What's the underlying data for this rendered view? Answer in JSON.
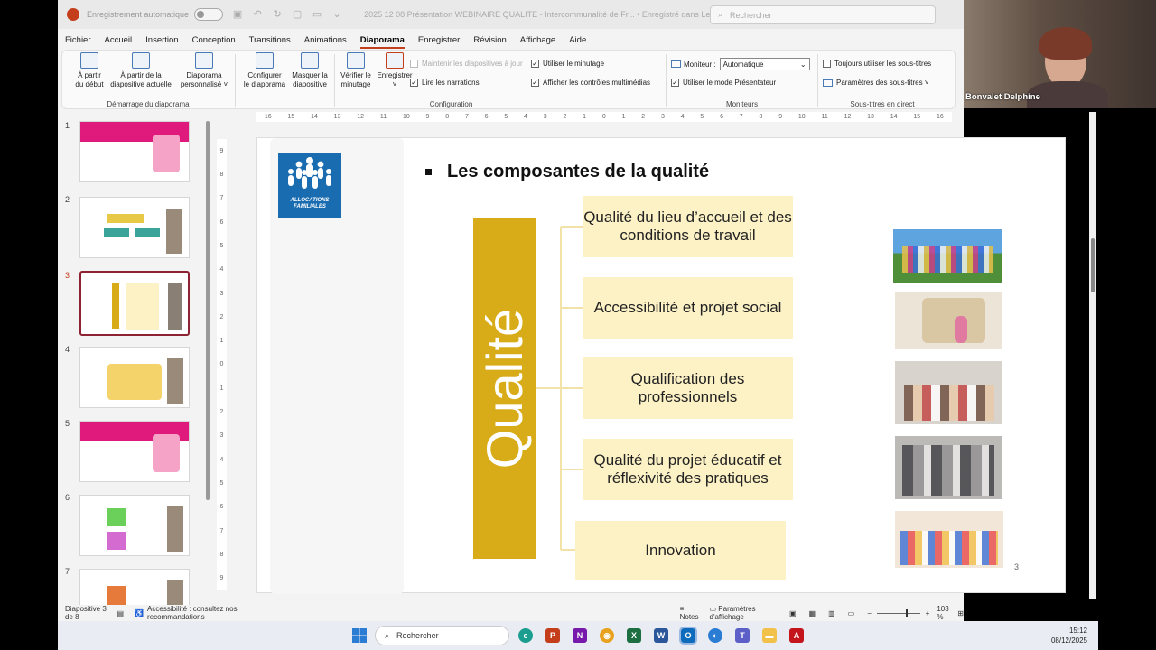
{
  "titlebar": {
    "autosave_label": "Enregistrement automatique",
    "doc_title": "2025 12 08 Présentation WEBINAIRE QUALITE - Intercommunalité de Fr...  •  Enregistré dans Lecteur N...",
    "search_placeholder": "Rechercher"
  },
  "menu": [
    "Fichier",
    "Accueil",
    "Insertion",
    "Conception",
    "Transitions",
    "Animations",
    "Diaporama",
    "Enregistrer",
    "Révision",
    "Affichage",
    "Aide"
  ],
  "ribbon": {
    "demarrage": {
      "btn1_l1": "À partir",
      "btn1_l2": "du début",
      "btn2_l1": "À partir de la",
      "btn2_l2": "diapositive actuelle",
      "btn3_l1": "Diaporama",
      "btn3_l2": "personnalisé ˅",
      "label": "Démarrage du diaporama"
    },
    "configuration": {
      "btn1_l1": "Configurer",
      "btn1_l2": "le diaporama",
      "btn2_l1": "Masquer la",
      "btn2_l2": "diapositive",
      "btn3_l1": "Vérifier le",
      "btn3_l2": "minutage",
      "btn4_l1": "Enregistrer",
      "btn4_l2": "˅",
      "opt_maintenir": "Maintenir les diapositives à jour",
      "opt_narrations": "Lire les narrations",
      "opt_minutage": "Utiliser le minutage",
      "opt_controles": "Afficher les contrôles multimédias",
      "label": "Configuration"
    },
    "moniteurs": {
      "moniteur_label": "Moniteur :",
      "moniteur_value": "Automatique",
      "presentateur": "Utiliser le mode Présentateur",
      "label": "Moniteurs"
    },
    "soustitres": {
      "toujours": "Toujours utiliser les sous-titres",
      "parametres": "Paramètres des sous-titres ˅",
      "label": "Sous-titres en direct"
    }
  },
  "thumbnails": {
    "numbers": [
      "1",
      "2",
      "3",
      "4",
      "5",
      "6",
      "7"
    ],
    "selected_index": 3
  },
  "ruler": {
    "h": [
      "16",
      "15",
      "14",
      "13",
      "12",
      "11",
      "10",
      "9",
      "8",
      "7",
      "6",
      "5",
      "4",
      "3",
      "2",
      "1",
      "0",
      "1",
      "2",
      "3",
      "4",
      "5",
      "6",
      "7",
      "8",
      "9",
      "10",
      "11",
      "12",
      "13",
      "14",
      "15",
      "16"
    ],
    "v": [
      "9",
      "8",
      "7",
      "6",
      "5",
      "4",
      "3",
      "2",
      "1",
      "0",
      "1",
      "2",
      "3",
      "4",
      "5",
      "6",
      "7",
      "8",
      "9"
    ]
  },
  "slide": {
    "logo_text": "ALLOCATIONS FAMILIALES",
    "title": "Les composantes de la qualité",
    "vertical_label": "Qualité",
    "items": [
      "Qualité du lieu d’accueil et des conditions de travail",
      "Accessibilité et projet social",
      "Qualification des professionnels",
      "Qualité du projet éducatif et réflexivité des pratiques",
      "Innovation"
    ],
    "page_number": "3"
  },
  "status": {
    "slide_info": "Diapositive 3 de 8",
    "accessibility": "Accessibilité : consultez nos recommandations",
    "notes": "Notes",
    "display_settings": "Paramètres d'affichage",
    "zoom": "103 %"
  },
  "webcam": {
    "name": "Bonvalet Delphine"
  },
  "taskbar": {
    "search": "Rechercher",
    "time": "15:12",
    "date": "08/12/2025"
  },
  "colors": {
    "accent": "#c43e1c",
    "gold": "#d8ac18",
    "cream": "#fdf2c6",
    "caf_blue": "#1a6cb0"
  }
}
